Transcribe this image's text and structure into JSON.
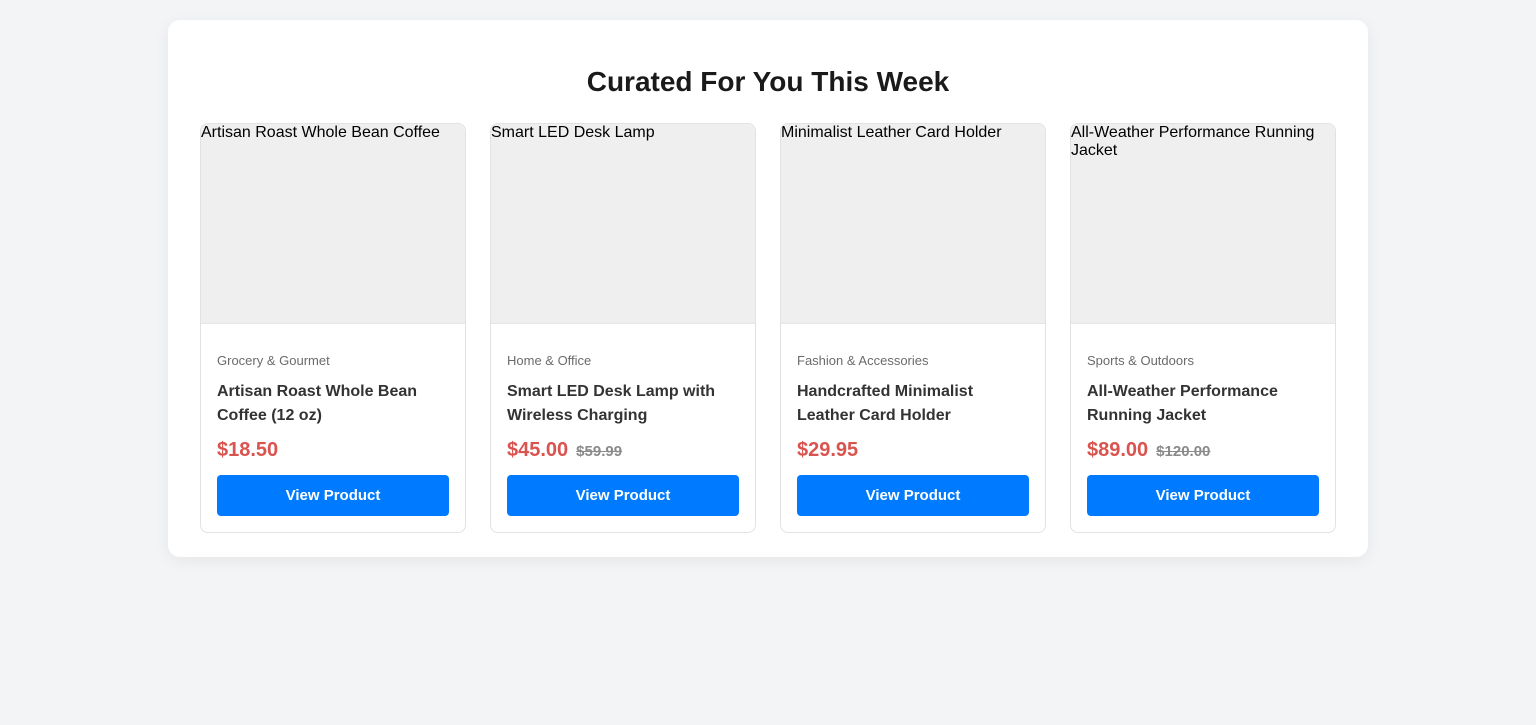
{
  "section": {
    "title": "Curated For You This Week"
  },
  "products": [
    {
      "image_alt": "Artisan Roast Whole Bean Coffee",
      "category": "Grocery & Gourmet",
      "name": "Artisan Roast Whole Bean Coffee (12 oz)",
      "price": "$18.50",
      "old_price": "",
      "button_label": "View Product"
    },
    {
      "image_alt": "Smart LED Desk Lamp",
      "category": "Home & Office",
      "name": "Smart LED Desk Lamp with Wireless Charging",
      "price": "$45.00",
      "old_price": "$59.99",
      "button_label": "View Product"
    },
    {
      "image_alt": "Minimalist Leather Card Holder",
      "category": "Fashion & Accessories",
      "name": "Handcrafted Minimalist Leather Card Holder",
      "price": "$29.95",
      "old_price": "",
      "button_label": "View Product"
    },
    {
      "image_alt": "All-Weather Performance Running Jacket",
      "category": "Sports & Outdoors",
      "name": "All-Weather Performance Running Jacket",
      "price": "$89.00",
      "old_price": "$120.00",
      "button_label": "View Product"
    }
  ],
  "colors": {
    "background": "#f3f4f6",
    "panel": "#ffffff",
    "price": "#d9534f",
    "old_price": "#8a8a8a",
    "button": "#007bff",
    "image_placeholder": "#efefef"
  }
}
